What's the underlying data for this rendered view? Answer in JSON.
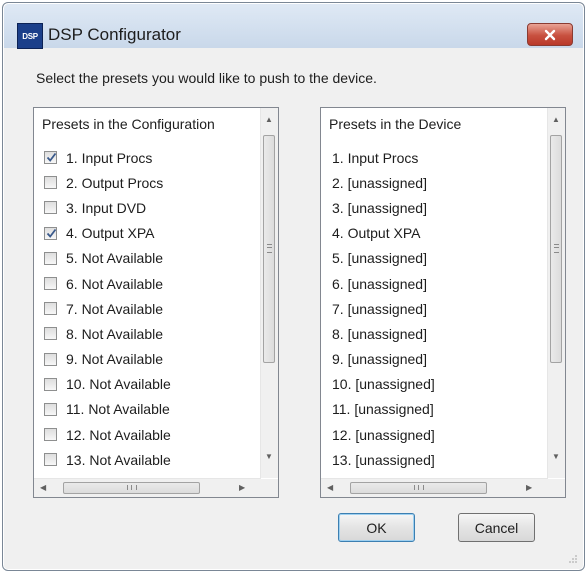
{
  "window": {
    "title": "DSP Configurator",
    "app_icon_text": "DSP",
    "icon": "app-icon",
    "close_icon": "close-icon"
  },
  "instruction": "Select the presets you would like to push to the device.",
  "left_list": {
    "header": "Presets in the Configuration",
    "items": [
      {
        "label": "1. Input Procs",
        "checked": true
      },
      {
        "label": "2. Output Procs",
        "checked": false
      },
      {
        "label": "3. Input DVD",
        "checked": false
      },
      {
        "label": "4. Output XPA",
        "checked": true
      },
      {
        "label": "5. Not Available",
        "checked": false
      },
      {
        "label": "6. Not Available",
        "checked": false
      },
      {
        "label": "7. Not Available",
        "checked": false
      },
      {
        "label": "8. Not Available",
        "checked": false
      },
      {
        "label": "9. Not Available",
        "checked": false
      },
      {
        "label": "10. Not Available",
        "checked": false
      },
      {
        "label": "11. Not Available",
        "checked": false
      },
      {
        "label": "12. Not Available",
        "checked": false
      },
      {
        "label": "13. Not Available",
        "checked": false
      }
    ]
  },
  "right_list": {
    "header": "Presets in the Device",
    "items": [
      "1. Input Procs",
      "2. [unassigned]",
      "3. [unassigned]",
      "4. Output XPA",
      "5. [unassigned]",
      "6. [unassigned]",
      "7. [unassigned]",
      "8. [unassigned]",
      "9. [unassigned]",
      "10. [unassigned]",
      "11. [unassigned]",
      "12. [unassigned]",
      "13. [unassigned]"
    ]
  },
  "buttons": {
    "ok": "OK",
    "cancel": "Cancel"
  },
  "colors": {
    "close_button": "#c8503f",
    "app_icon": "#1b3f8a",
    "default_button_border": "#3c7fb1"
  }
}
